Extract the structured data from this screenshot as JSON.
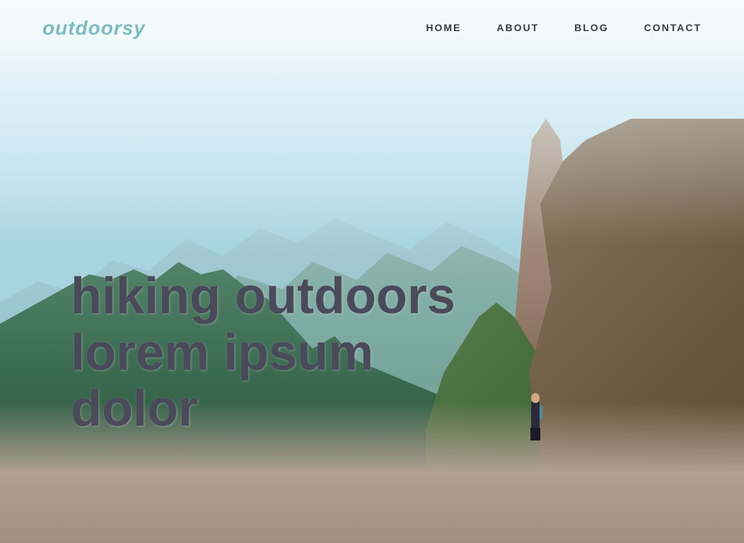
{
  "brand": {
    "name": "outdoorsy"
  },
  "nav": {
    "items": [
      {
        "label": "HOME",
        "id": "home"
      },
      {
        "label": "ABOUT",
        "id": "about"
      },
      {
        "label": "BLOG",
        "id": "blog"
      },
      {
        "label": "CONTACT",
        "id": "contact"
      }
    ]
  },
  "hero": {
    "line1": "hiking outdoors",
    "line2": "lorem ipsum",
    "line3": "dolor"
  },
  "colors": {
    "brand": "#7bbcc0",
    "navText": "#3a3a3a",
    "heroText": "#4a4a5a"
  }
}
